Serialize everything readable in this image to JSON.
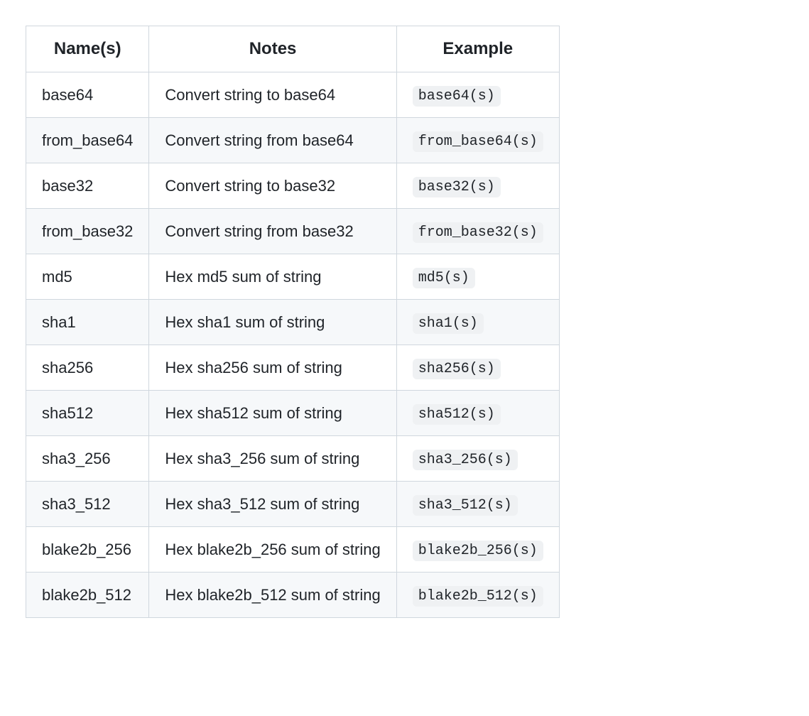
{
  "table": {
    "headers": [
      "Name(s)",
      "Notes",
      "Example"
    ],
    "rows": [
      {
        "name": "base64",
        "notes": "Convert string to base64",
        "example": "base64(s)"
      },
      {
        "name": "from_base64",
        "notes": "Convert string from base64",
        "example": "from_base64(s)"
      },
      {
        "name": "base32",
        "notes": "Convert string to base32",
        "example": "base32(s)"
      },
      {
        "name": "from_base32",
        "notes": "Convert string from base32",
        "example": "from_base32(s)"
      },
      {
        "name": "md5",
        "notes": "Hex md5 sum of string",
        "example": "md5(s)"
      },
      {
        "name": "sha1",
        "notes": "Hex sha1 sum of string",
        "example": "sha1(s)"
      },
      {
        "name": "sha256",
        "notes": "Hex sha256 sum of string",
        "example": "sha256(s)"
      },
      {
        "name": "sha512",
        "notes": "Hex sha512 sum of string",
        "example": "sha512(s)"
      },
      {
        "name": "sha3_256",
        "notes": "Hex sha3_256 sum of string",
        "example": "sha3_256(s)"
      },
      {
        "name": "sha3_512",
        "notes": "Hex sha3_512 sum of string",
        "example": "sha3_512(s)"
      },
      {
        "name": "blake2b_256",
        "notes": "Hex blake2b_256 sum of string",
        "example": "blake2b_256(s)"
      },
      {
        "name": "blake2b_512",
        "notes": "Hex blake2b_512 sum of string",
        "example": "blake2b_512(s)"
      }
    ]
  }
}
